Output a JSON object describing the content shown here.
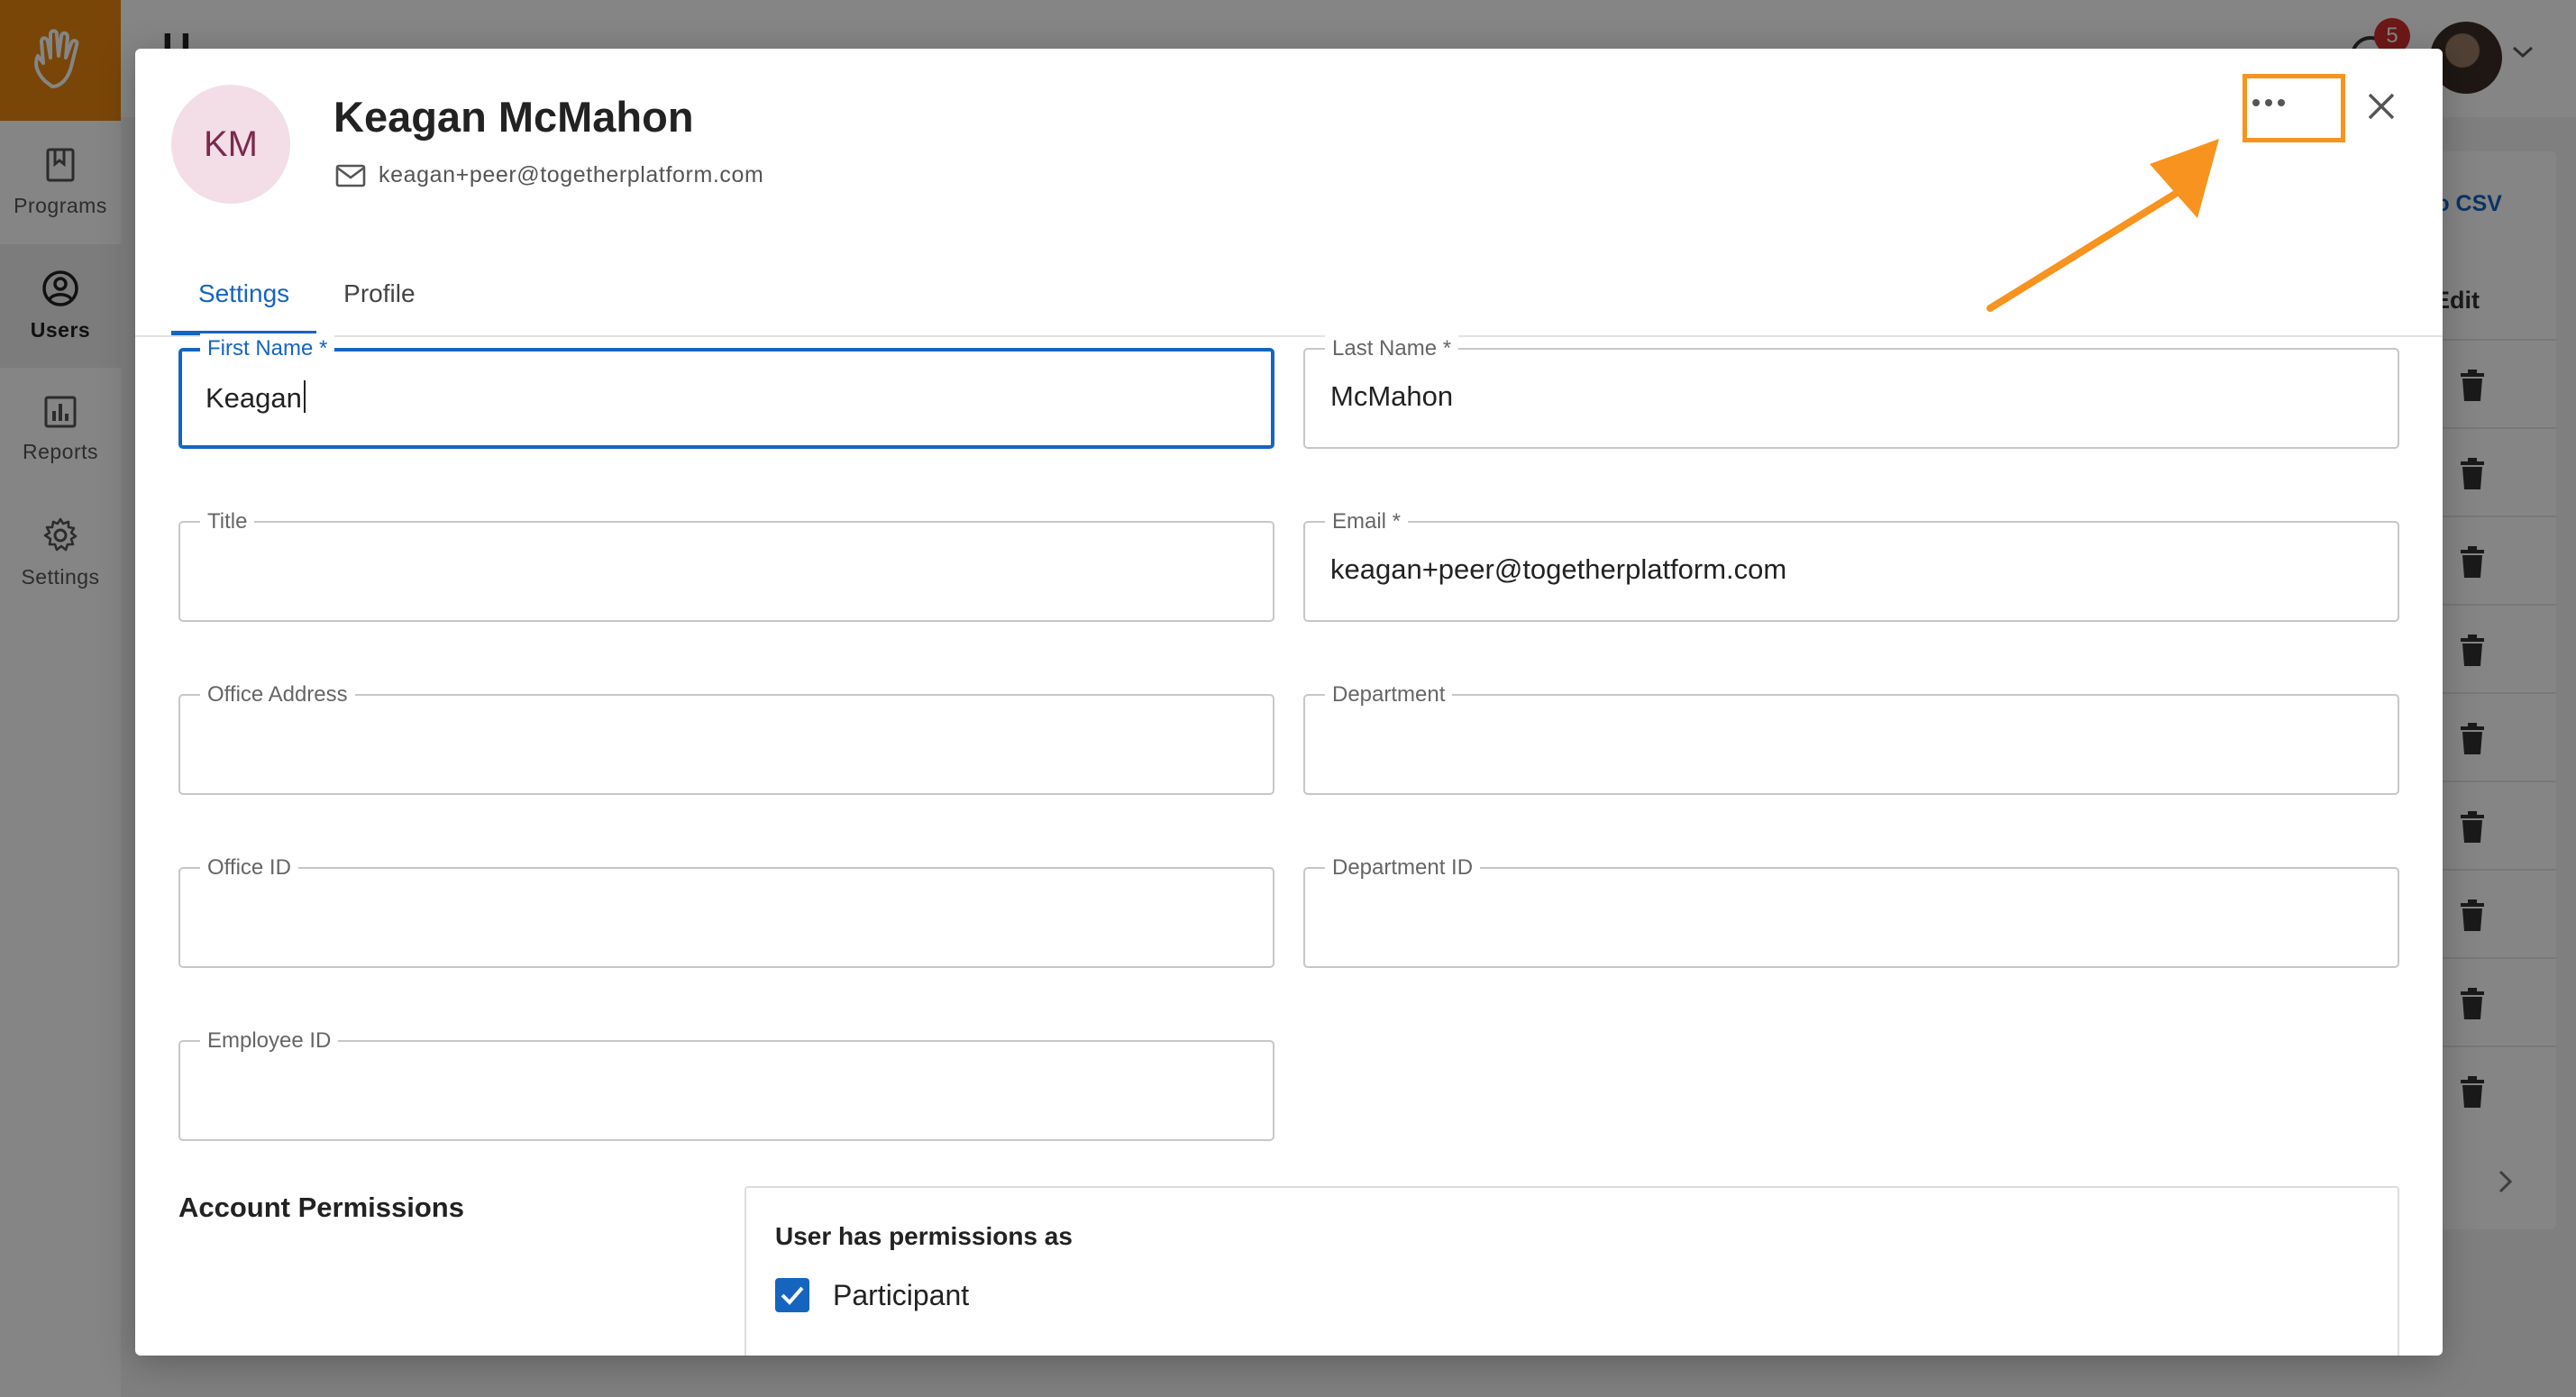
{
  "sidebar": {
    "items": [
      {
        "label": "Programs",
        "icon": "bookmark-icon",
        "active": false
      },
      {
        "label": "Users",
        "icon": "user-circle-icon",
        "active": true
      },
      {
        "label": "Reports",
        "icon": "bar-chart-icon",
        "active": false
      },
      {
        "label": "Settings",
        "icon": "gear-icon",
        "active": false
      }
    ]
  },
  "topbar": {
    "page_title": "U",
    "notification_count": "5"
  },
  "background_table": {
    "export_label": "to CSV",
    "edit_header": "Edit"
  },
  "modal": {
    "initials": "KM",
    "name": "Keagan McMahon",
    "email": "keagan+peer@togetherplatform.com",
    "tabs": [
      {
        "label": "Settings",
        "active": true
      },
      {
        "label": "Profile",
        "active": false
      }
    ],
    "fields": {
      "first_name": {
        "label": "First Name *",
        "value": "Keagan"
      },
      "last_name": {
        "label": "Last Name *",
        "value": "McMahon"
      },
      "title": {
        "label": "Title",
        "value": ""
      },
      "email": {
        "label": "Email *",
        "value": "keagan+peer@togetherplatform.com"
      },
      "office_address": {
        "label": "Office Address",
        "value": ""
      },
      "department": {
        "label": "Department",
        "value": ""
      },
      "office_id": {
        "label": "Office ID",
        "value": ""
      },
      "department_id": {
        "label": "Department ID",
        "value": ""
      },
      "employee_id": {
        "label": "Employee ID",
        "value": ""
      }
    },
    "permissions": {
      "title": "Account Permissions",
      "subtitle": "User has permissions as",
      "options": [
        {
          "label": "Participant",
          "checked": true
        }
      ]
    }
  },
  "colors": {
    "brand": "#e8870e",
    "accent": "#1565c0",
    "highlight": "#f7931e",
    "badge": "#d32f2f"
  }
}
